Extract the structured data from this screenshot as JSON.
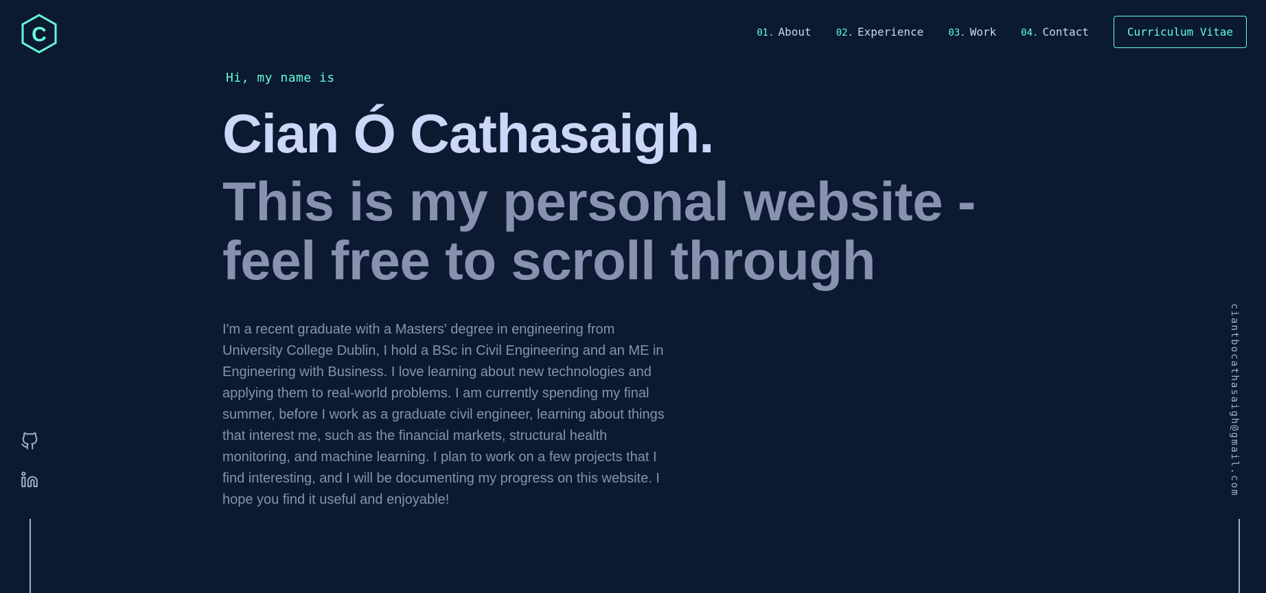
{
  "brand": {
    "logo_letter": "C",
    "accent_color": "#64ffda",
    "background_color": "#0b1931"
  },
  "nav": {
    "items": [
      {
        "num": "01.",
        "label": "About"
      },
      {
        "num": "02.",
        "label": "Experience"
      },
      {
        "num": "03.",
        "label": "Work"
      },
      {
        "num": "04.",
        "label": "Contact"
      }
    ],
    "cv_label": "Curriculum Vitae"
  },
  "hero": {
    "intro": "Hi, my name is",
    "name": "Cian Ó Cathasaigh.",
    "tagline": "This is my personal website - feel free to scroll through",
    "bio": "I'm a recent graduate with a Masters' degree in engineering from University College Dublin, I hold a BSc in Civil Engineering and an ME in Engineering with Business. I love learning about new technologies and applying them to real-world problems. I am currently spending my final summer, before I work as a graduate civil engineer, learning about things that interest me, such as the financial markets, structural health monitoring, and machine learning. I plan to work on a few projects that I find interesting, and I will be documenting my progress on this website. I hope you find it useful and enjoyable!"
  },
  "social": {
    "icons": [
      "github-icon",
      "linkedin-icon"
    ]
  },
  "side": {
    "email": "ciantbocathasaigh@gmail.com"
  }
}
